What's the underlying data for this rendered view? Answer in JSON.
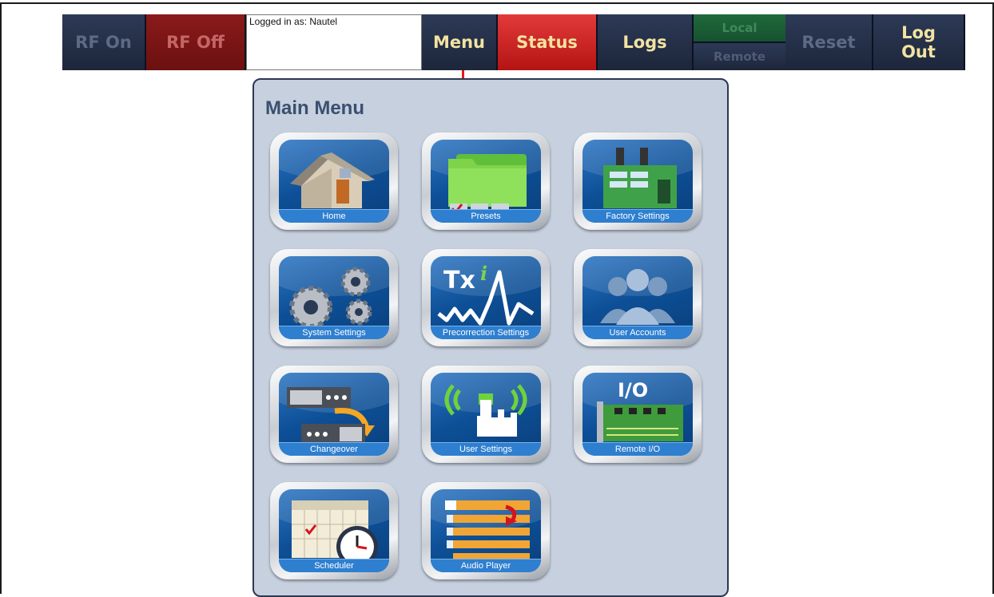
{
  "toolbar": {
    "rf_on": "RF On",
    "rf_off": "RF Off",
    "login_text": "Logged in as: Nautel",
    "menu": "Menu",
    "status": "Status",
    "logs": "Logs",
    "local": "Local",
    "remote": "Remote",
    "reset": "Reset",
    "logout_line1": "Log",
    "logout_line2": "Out"
  },
  "main_menu": {
    "title": "Main Menu",
    "items": [
      {
        "label": "Home",
        "icon": "home-icon"
      },
      {
        "label": "Presets",
        "icon": "presets-folder-icon"
      },
      {
        "label": "Factory Settings",
        "icon": "factory-icon"
      },
      {
        "label": "System Settings",
        "icon": "gears-icon"
      },
      {
        "label": "Precorrection Settings",
        "icon": "txi-waveform-icon"
      },
      {
        "label": "User Accounts",
        "icon": "users-icon"
      },
      {
        "label": "Changeover",
        "icon": "changeover-icon"
      },
      {
        "label": "User Settings",
        "icon": "touch-wireless-icon"
      },
      {
        "label": "Remote I/O",
        "icon": "io-board-icon"
      },
      {
        "label": "Scheduler",
        "icon": "calendar-clock-icon"
      },
      {
        "label": "Audio Player",
        "icon": "playlist-icon"
      }
    ]
  },
  "colors": {
    "toolbar_navy": "#1d263a",
    "status_red": "#d02828",
    "menu_text": "#f2e3a1",
    "panel_bg": "#c6d0df",
    "arrow_red": "#e3191b"
  }
}
